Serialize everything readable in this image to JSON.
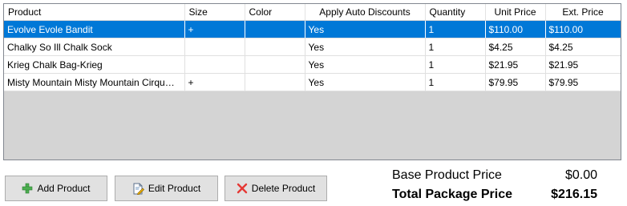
{
  "grid": {
    "columns": [
      "Product",
      "Size",
      "Color",
      "Apply Auto Discounts",
      "Quantity",
      "Unit Price",
      "Ext. Price"
    ],
    "rows": [
      {
        "product": "Evolve Evole Bandit",
        "size": "+",
        "color": "",
        "apply_auto_discounts": "Yes",
        "quantity": "1",
        "unit_price": "$110.00",
        "ext_price": "$110.00",
        "selected": true
      },
      {
        "product": "Chalky So Ill Chalk Sock",
        "size": "",
        "color": "",
        "apply_auto_discounts": "Yes",
        "quantity": "1",
        "unit_price": "$4.25",
        "ext_price": "$4.25",
        "selected": false
      },
      {
        "product": "Krieg Chalk Bag-Krieg",
        "size": "",
        "color": "",
        "apply_auto_discounts": "Yes",
        "quantity": "1",
        "unit_price": "$21.95",
        "ext_price": "$21.95",
        "selected": false
      },
      {
        "product": "Misty Mountain Misty Mountain Cirqu…",
        "size": "+",
        "color": "",
        "apply_auto_discounts": "Yes",
        "quantity": "1",
        "unit_price": "$79.95",
        "ext_price": "$79.95",
        "selected": false
      }
    ],
    "selection_color": "#0078d7"
  },
  "buttons": {
    "add": {
      "label": "Add Product",
      "icon": "plus-icon"
    },
    "edit": {
      "label": "Edit Product",
      "icon": "edit-document-icon"
    },
    "delete": {
      "label": "Delete Product",
      "icon": "red-x-icon"
    }
  },
  "summary": {
    "base_label": "Base Product Price",
    "base_value": "$0.00",
    "total_label": "Total Package Price",
    "total_value": "$216.15"
  }
}
